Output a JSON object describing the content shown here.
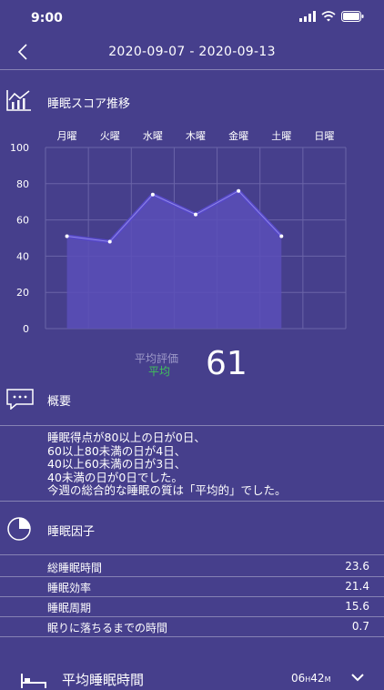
{
  "status": {
    "time": "9:00"
  },
  "header": {
    "title": "2020-09-07 - 2020-09-13"
  },
  "trend_section": {
    "title": "睡眠スコア推移"
  },
  "chart_data": {
    "type": "area",
    "categories": [
      "月曜",
      "火曜",
      "水曜",
      "木曜",
      "金曜",
      "土曜",
      "日曜"
    ],
    "series": [
      {
        "values": [
          51,
          48,
          74,
          63,
          76,
          51,
          null
        ]
      }
    ],
    "y_ticks": [
      "0",
      "20",
      "40",
      "60",
      "80",
      "100"
    ],
    "ylim": [
      0,
      100
    ],
    "grid": true,
    "colors": {
      "line": "#5648c8",
      "fill": "#5a4fb8",
      "grid": "#6a64a8"
    }
  },
  "score": {
    "label": "平均評価",
    "grade": "平均",
    "value": "61",
    "grade_color": "#41c25a"
  },
  "summary_section": {
    "title": "概要",
    "text": "睡眠得点が80以上の日が0日、\n60以上80未満の日が4日、\n40以上60未満の日が3日、\n40未満の日が0日でした。\n今週の総合的な睡眠の質は「平均的」でした。"
  },
  "factors_section": {
    "title": "睡眠因子",
    "items": [
      {
        "name": "総睡眠時間",
        "value": "23.6"
      },
      {
        "name": "睡眠効率",
        "value": "21.4"
      },
      {
        "name": "睡眠周期",
        "value": "15.6"
      },
      {
        "name": "眠りに落ちるまでの時間",
        "value": "0.7"
      }
    ]
  },
  "bottom_card": {
    "title": "平均睡眠時間",
    "value": "06",
    "unit_h": "H",
    "minutes": "42",
    "unit_m": "M"
  }
}
